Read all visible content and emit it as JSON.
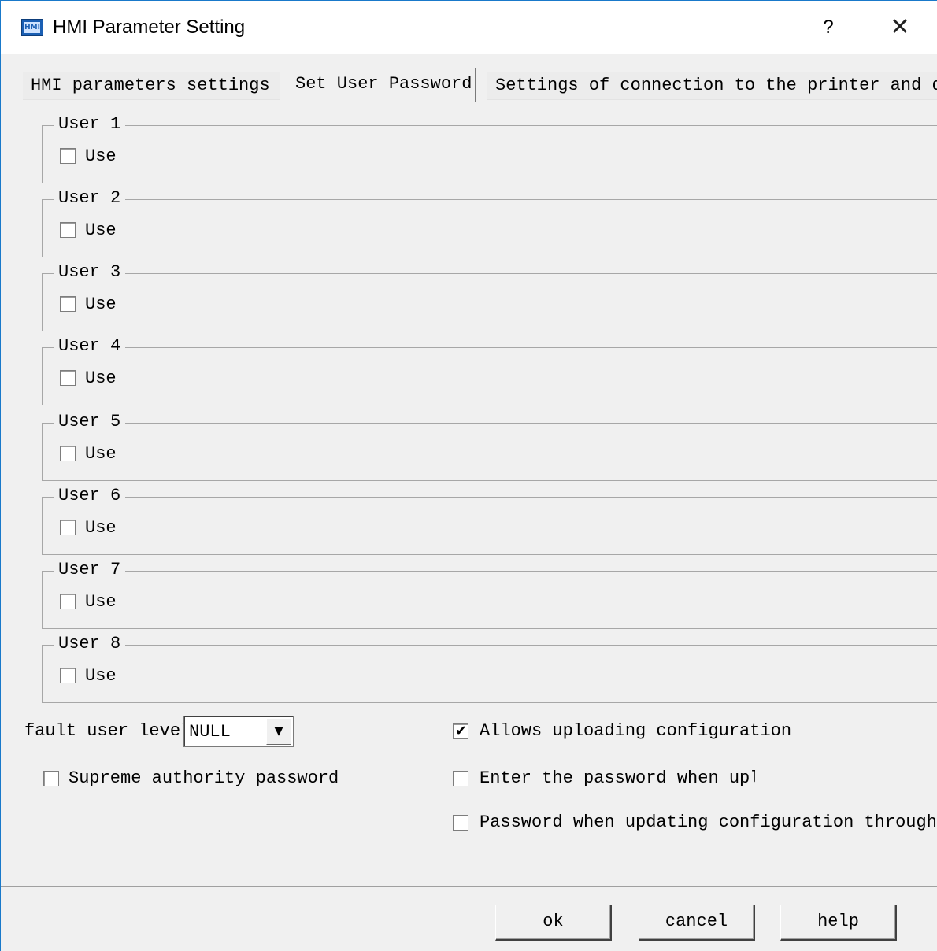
{
  "window": {
    "title": "HMI Parameter Setting",
    "help_symbol": "?",
    "close_symbol": "✕",
    "icon_text": "HMI"
  },
  "tabs": [
    {
      "label": "HMI parameters settings",
      "active": false
    },
    {
      "label": "Set User Password",
      "active": true
    },
    {
      "label": "Settings of connection to the printer and downl",
      "active": false
    }
  ],
  "users": [
    {
      "legend": "User 1",
      "use_label": "Use",
      "checked": false
    },
    {
      "legend": "User 2",
      "use_label": "Use",
      "checked": false
    },
    {
      "legend": "User 3",
      "use_label": "Use",
      "checked": false
    },
    {
      "legend": "User 4",
      "use_label": "Use",
      "checked": false
    },
    {
      "legend": "User 5",
      "use_label": "Use",
      "checked": false
    },
    {
      "legend": "User 6",
      "use_label": "Use",
      "checked": false
    },
    {
      "legend": "User 7",
      "use_label": "Use",
      "checked": false
    },
    {
      "legend": "User 8",
      "use_label": "Use",
      "checked": false
    }
  ],
  "default_user_level": {
    "label": "fault user level:",
    "value": "NULL"
  },
  "options": {
    "supreme_password": {
      "label": "Supreme authority password",
      "checked": false
    },
    "allow_upload": {
      "label": "Allows uploading configuration",
      "checked": true
    },
    "password_upload": {
      "label": "Enter the password when uploс",
      "checked": false
    },
    "password_udisk": {
      "label": "Password when updating configuration through U d",
      "checked": false
    }
  },
  "buttons": {
    "ok": "ok",
    "cancel": "cancel",
    "help": "help"
  }
}
